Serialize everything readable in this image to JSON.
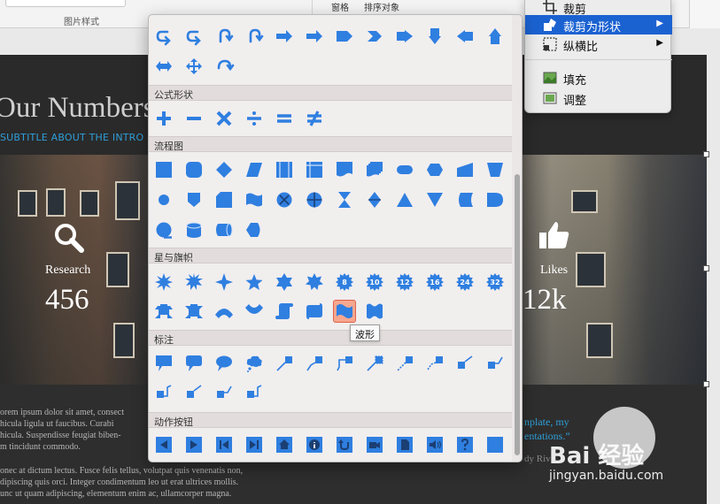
{
  "ribbon": {
    "picture_styles_group": "图片样式",
    "pane": "窗格",
    "arrange_objects": "排序对象"
  },
  "context_menu": {
    "items": [
      {
        "label": "裁剪",
        "icon": "crop-icon"
      },
      {
        "label": "裁剪为形状",
        "icon": "crop-to-shape-icon",
        "submenu": true,
        "active": true
      },
      {
        "label": "纵横比",
        "icon": "aspect-ratio-icon",
        "submenu": true
      },
      {
        "label": "填充",
        "icon": "fill-image-icon"
      },
      {
        "label": "调整",
        "icon": "fit-image-icon"
      }
    ]
  },
  "shapes_panel": {
    "sections": [
      {
        "title": "",
        "shape_count": 16
      },
      {
        "title": "公式形状",
        "shape_count": 6
      },
      {
        "title": "流程图",
        "shape_count": 28
      },
      {
        "title": "星与旗帜",
        "shape_count": 20
      },
      {
        "title": "标注",
        "shape_count": 16
      },
      {
        "title": "动作按钮",
        "shape_count": 12
      }
    ],
    "star_labels": [
      "8",
      "10",
      "12",
      "16",
      "24",
      "32"
    ],
    "tooltip": "波形",
    "accent": "#2f7fe0",
    "selected_shape": "wave"
  },
  "slide": {
    "title": "Our Numbers",
    "subtitle": "SUBTITLE ABOUT THE INTRO",
    "stats": [
      {
        "icon": "magnifier-icon",
        "label": "Research",
        "value": "456"
      },
      {
        "icon": "thumbs-up-icon",
        "label": "Likes",
        "value": "12k"
      }
    ],
    "paragraph_lines": [
      "orem ipsum dolor sit amet, consect",
      "hicula ligula ut faucibus. Curabi",
      "hicula. Suspendisse feugiat biben-",
      "m tincidunt commodo."
    ],
    "paragraph2_lines": [
      "onec at dictum lectus. Fusce felis tellus, volutpat quis venenatis non,",
      "dipiscing quis orci. Integer condimentum leo ut erat ultrices mollis.",
      "unc ut quam adipiscing, elementum enim ac, ullamcorper magna."
    ],
    "quote_lines": [
      "nplate, my",
      "entations.”"
    ],
    "quote_author": "dy Riv"
  },
  "watermark": {
    "brand": "Bai  经验",
    "url": "jingyan.baidu.com"
  }
}
